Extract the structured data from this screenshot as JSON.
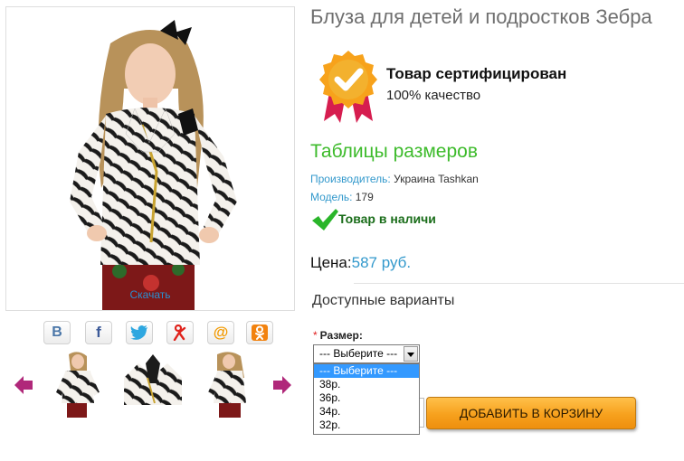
{
  "product": {
    "title": "Блуза для детей и подростков Зебра",
    "download_label": "Скачать"
  },
  "certificate": {
    "title": "Товар сертифицирован",
    "subtitle": "100% качество",
    "colors": {
      "badge": "#f7a21b",
      "ribbon": "#d61d4f"
    }
  },
  "size_tables": {
    "label": "Таблицы размеров",
    "color": "#3dbb2b"
  },
  "specs": {
    "manufacturer_label": "Производитель:",
    "manufacturer_value": "Украина Tashkan",
    "model_label": "Модель:",
    "model_value": "179"
  },
  "stock": {
    "label": "Товар в наличи",
    "icon": "checkmark-icon"
  },
  "price": {
    "label": "Цена:",
    "value": "587 руб."
  },
  "options": {
    "heading": "Доступные варианты",
    "size_required_mark": "*",
    "size_label": "Размер:",
    "selected": "--- Выберите ---",
    "dropdown_items": [
      "--- Выберите ---",
      "38р.",
      "36р.",
      "34р.",
      "32р."
    ]
  },
  "cart": {
    "button_label": "ДОБАВИТЬ В КОРЗИНУ"
  },
  "share": {
    "icons": [
      "vk-icon",
      "facebook-icon",
      "twitter-icon",
      "odnoklassniki-ya-icon",
      "mail-ru-icon",
      "odnoklassniki-icon"
    ],
    "letters": {
      "vk": "B",
      "facebook": "f",
      "mail": "@"
    }
  },
  "gallery": {
    "prev_icon": "arrow-left-icon",
    "next_icon": "arrow-right-icon",
    "arrow_color": "#b0287a"
  }
}
